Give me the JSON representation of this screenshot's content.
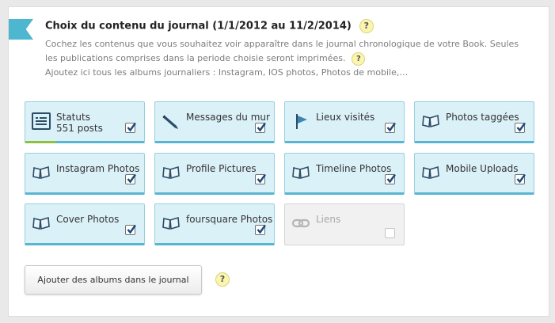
{
  "header": {
    "title": "Choix du contenu du journal (1/1/2012 au 11/2/2014)",
    "help": "?"
  },
  "description": {
    "line1": "Cochez les contenus que vous souhaitez voir apparaître dans le journal chronologique de votre Book. Seules",
    "line2": "les publications comprises dans la periode choisie seront imprimées.",
    "line3": "Ajoutez ici tous les albums journaliers : Instagram, IOS photos, Photos de mobile,…",
    "help": "?"
  },
  "tiles": [
    {
      "label": "Statuts",
      "sublabel": "551 posts",
      "icon": "status-icon",
      "checked": true,
      "progress_fraction": 0.26
    },
    {
      "label": "Messages du mur",
      "icon": "pencil-icon",
      "checked": true
    },
    {
      "label": "Lieux visités",
      "icon": "flag-icon",
      "checked": true
    },
    {
      "label": "Photos taggées",
      "icon": "photo-icon",
      "checked": true
    },
    {
      "label": "Instagram Photos",
      "icon": "photo-icon",
      "checked": true
    },
    {
      "label": "Profile Pictures",
      "icon": "photo-icon",
      "checked": true
    },
    {
      "label": "Timeline Photos",
      "icon": "photo-icon",
      "checked": true
    },
    {
      "label": "Mobile Uploads",
      "icon": "photo-icon",
      "checked": true
    },
    {
      "label": "Cover Photos",
      "icon": "photo-icon",
      "checked": true
    },
    {
      "label": "foursquare Photos",
      "icon": "photo-icon",
      "checked": true
    },
    {
      "label": "Liens",
      "icon": "link-icon",
      "checked": false,
      "disabled": true
    }
  ],
  "add_albums": {
    "label": "Ajouter des albums dans le journal",
    "help": "?"
  },
  "colors": {
    "accent": "#4fb6cf",
    "tile_bg": "#dbf1f8",
    "tile_border": "#59b5d1",
    "progress": "#8fc13c",
    "help_bg": "#fbf5b0"
  }
}
